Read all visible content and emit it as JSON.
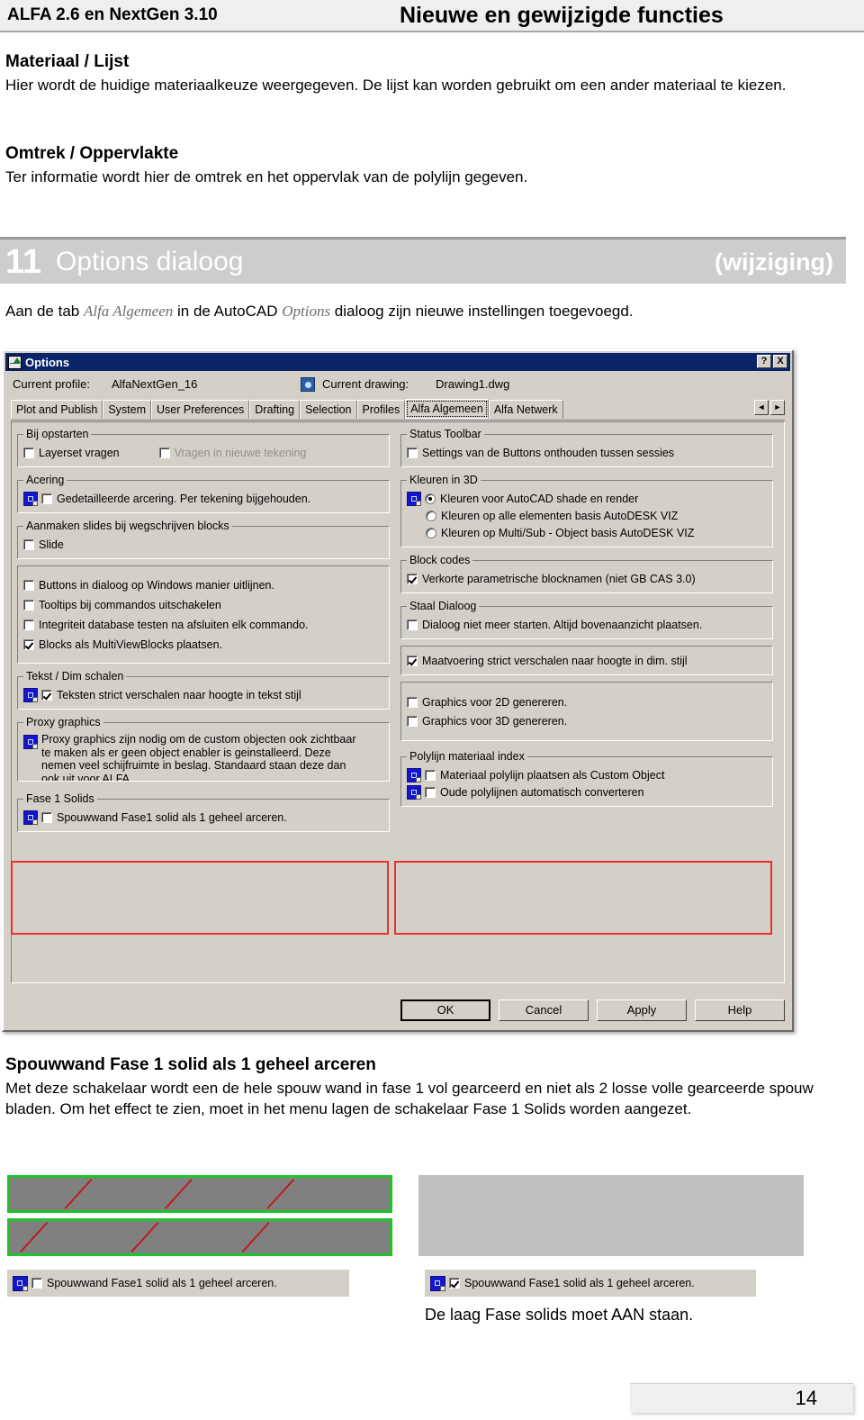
{
  "header": {
    "left": "ALFA 2.6 en NextGen 3.10",
    "right": "Nieuwe en gewijzigde functies"
  },
  "sections": [
    {
      "heading": "Materiaal / Lijst",
      "body": "Hier wordt de huidige materiaalkeuze weergegeven. De lijst kan worden gebruikt om een ander materiaal te kiezen."
    },
    {
      "heading": "Omtrek / Oppervlakte",
      "body": "Ter informatie wordt hier de omtrek en het oppervlak van de polylijn gegeven."
    }
  ],
  "chapter": {
    "number": "11",
    "title": "Options dialoog",
    "tag": "(wijziging)",
    "intro_1": "Aan de tab ",
    "intro_em1": "Alfa Algemeen",
    "intro_2": " in de AutoCAD ",
    "intro_em2": "Options",
    "intro_3": " dialoog zijn nieuwe instellingen toegevoegd."
  },
  "dialog": {
    "title": "Options",
    "titlebar_help": "?",
    "titlebar_close": "X",
    "current_profile_label": "Current profile:",
    "current_profile_value": "AlfaNextGen_16",
    "current_drawing_label": "Current drawing:",
    "current_drawing_value": "Drawing1.dwg",
    "tabs": [
      {
        "label": "Plot and Publish",
        "active": false
      },
      {
        "label": "System",
        "active": false
      },
      {
        "label": "User Preferences",
        "active": false
      },
      {
        "label": "Drafting",
        "active": false
      },
      {
        "label": "Selection",
        "active": false
      },
      {
        "label": "Profiles",
        "active": false
      },
      {
        "label": "Alfa Algemeen",
        "active": true
      },
      {
        "label": "Alfa Netwerk",
        "active": false
      }
    ],
    "tab_prev": "◄",
    "tab_next": "►",
    "left": {
      "g_bij_opstarten": {
        "legend": "Bij opstarten",
        "item_layerset": "Layerset vragen",
        "item_vragen": "Vragen in nieuwe tekening"
      },
      "g_acering": {
        "legend": "Acering",
        "item": "Gedetailleerde arcering. Per tekening bijgehouden."
      },
      "g_slides": {
        "legend": "Aanmaken slides bij wegschrijven blocks",
        "item": "Slide"
      },
      "loose": [
        "Buttons in dialoog op Windows manier uitlijnen.",
        "Tooltips bij commandos uitschakelen",
        "Integriteit database testen na afsluiten elk commando.",
        "Blocks als MultiViewBlocks plaatsen."
      ],
      "g_tekst_dim": {
        "legend": "Tekst / Dim schalen",
        "item": "Teksten strict verschalen naar hoogte in tekst stijl"
      },
      "g_proxy": {
        "legend": "Proxy graphics",
        "text": "Proxy graphics zijn nodig om de custom objecten ook zichtbaar te maken als er geen object enabler is geinstalleerd. Deze nemen veel schijfruimte in beslag. Standaard staan deze dan ook uit voor ALFA."
      },
      "g_fase1": {
        "legend": "Fase 1 Solids",
        "item": "Spouwwand Fase1 solid als 1 geheel arceren."
      }
    },
    "right": {
      "g_status_toolbar": {
        "legend": "Status Toolbar",
        "item": "Settings van de Buttons onthouden tussen sessies"
      },
      "g_kleuren3d": {
        "legend": "Kleuren in 3D",
        "options": [
          "Kleuren voor AutoCAD shade en render",
          "Kleuren op alle elementen basis AutoDESK VIZ",
          "Kleuren op Multi/Sub - Object basis AutoDESK VIZ"
        ]
      },
      "g_blockcodes": {
        "legend": "Block codes",
        "item": "Verkorte parametrische blocknamen (niet GB CAS 3.0)"
      },
      "g_staal": {
        "legend": "Staal Dialoog",
        "item": "Dialoog niet meer starten. Altijd bovenaanzicht plaatsen."
      },
      "loose_maatvoering": "Maatvoering strict verschalen naar hoogte in dim. stijl",
      "loose_graphics": [
        "Graphics voor 2D genereren.",
        "Graphics voor 3D genereren."
      ],
      "g_polylijn": {
        "legend": "Polylijn materiaal index",
        "items": [
          "Materiaal polylijn plaatsen als Custom Object",
          "Oude polylijnen automatisch converteren"
        ]
      }
    },
    "buttons": {
      "ok": "OK",
      "cancel": "Cancel",
      "apply": "Apply",
      "help": "Help"
    }
  },
  "explain": {
    "heading": "Spouwwand Fase 1 solid als 1 geheel arceren",
    "body": "Met deze schakelaar wordt een de hele spouw wand in fase 1 vol gearceerd en niet als 2 losse volle gearceerde spouw bladen. Om het effect te zien, moet in het menu lagen de schakelaar Fase 1 Solids worden aangezet."
  },
  "illustration": {
    "left_checkbox_label": "Spouwwand Fase1 solid als 1 geheel arceren.",
    "right_checkbox_label": "Spouwwand Fase1 solid als 1 geheel arceren.",
    "note": "De laag Fase solids moet AAN staan.",
    "colors": {
      "wall_outline": "#22c32a",
      "wall_fill": "#808080",
      "hatch_line": "#c01818",
      "flat_fill": "#c0c0c0"
    }
  },
  "footer": {
    "page": "14"
  }
}
